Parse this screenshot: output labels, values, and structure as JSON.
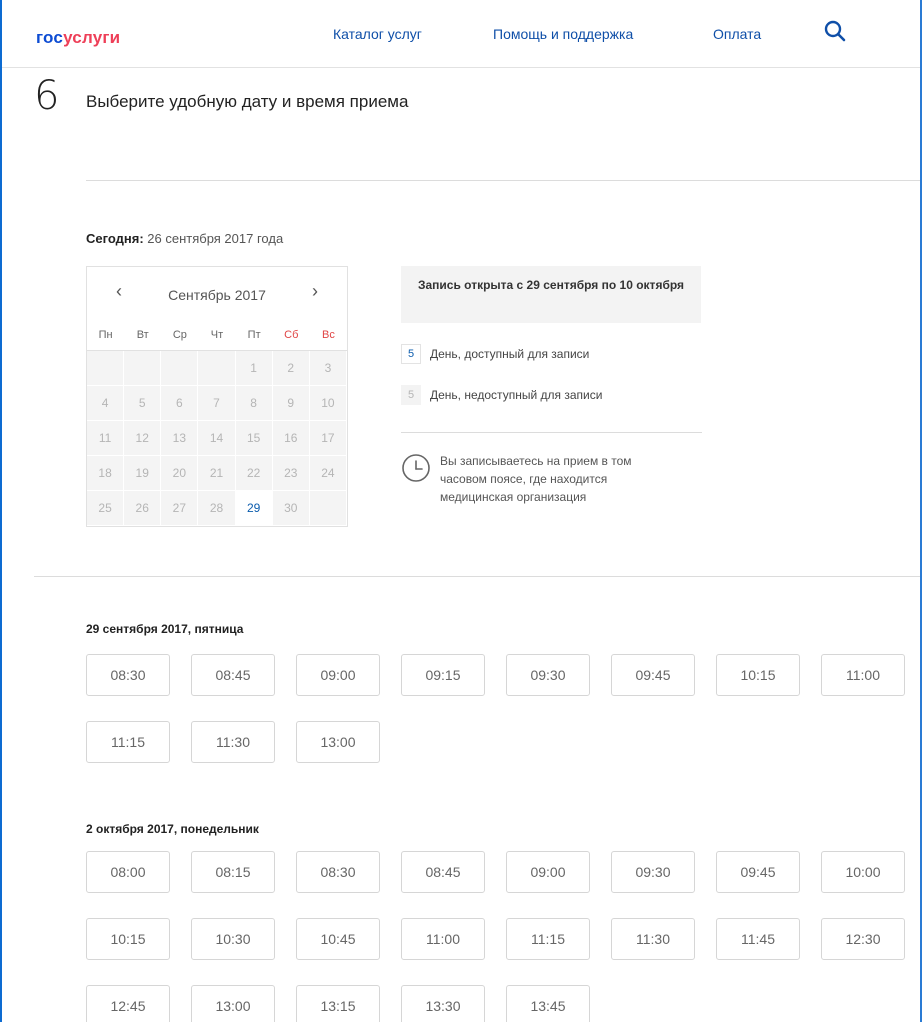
{
  "header": {
    "logo_part1": "гос",
    "logo_part2": "услуги",
    "nav": {
      "catalog": "Каталог услуг",
      "help": "Помощь и поддержка",
      "payment": "Оплата"
    },
    "search_icon": "search-icon"
  },
  "step": {
    "number": "6",
    "title": "Выберите удобную дату и время приема"
  },
  "today": {
    "label": "Сегодня:",
    "value": "26 сентября 2017 года"
  },
  "calendar": {
    "month_label": "Сентябрь 2017",
    "prev_symbol": "‹",
    "next_symbol": "›",
    "weekdays": [
      "Пн",
      "Вт",
      "Ср",
      "Чт",
      "Пт",
      "Сб",
      "Вс"
    ],
    "weeks": [
      [
        "",
        "",
        "",
        "",
        "1",
        "2",
        "3"
      ],
      [
        "4",
        "5",
        "6",
        "7",
        "8",
        "9",
        "10"
      ],
      [
        "11",
        "12",
        "13",
        "14",
        "15",
        "16",
        "17"
      ],
      [
        "18",
        "19",
        "20",
        "21",
        "22",
        "23",
        "24"
      ],
      [
        "25",
        "26",
        "27",
        "28",
        "29",
        "30",
        ""
      ]
    ],
    "available_days": [
      "29"
    ]
  },
  "info": {
    "booking_open": "Запись открыта с 29 сентября по 10 октября",
    "legend": {
      "available_number": "5",
      "available_text": "День, доступный для записи",
      "unavailable_number": "5",
      "unavailable_text": "День, недоступный для записи"
    },
    "timezone_note": "Вы записываетесь на прием в том часовом поясе, где находится медицинская организация"
  },
  "days": [
    {
      "label": "29 сентября 2017, пятница",
      "slots": [
        "08:30",
        "08:45",
        "09:00",
        "09:15",
        "09:30",
        "09:45",
        "10:15",
        "11:00",
        "11:15",
        "11:30",
        "13:00"
      ]
    },
    {
      "label": "2 октября 2017, понедельник",
      "slots": [
        "08:00",
        "08:15",
        "08:30",
        "08:45",
        "09:00",
        "09:30",
        "09:45",
        "10:00",
        "10:15",
        "10:30",
        "10:45",
        "11:00",
        "11:15",
        "11:30",
        "11:45",
        "12:30",
        "12:45",
        "13:00",
        "13:15",
        "13:30",
        "13:45"
      ]
    }
  ],
  "colors": {
    "accent": "#0d4cd3",
    "brand_red": "#ee3f58",
    "link": "#0f4fa8",
    "weekend": "#e04545",
    "available_day": "#0b5cad"
  }
}
